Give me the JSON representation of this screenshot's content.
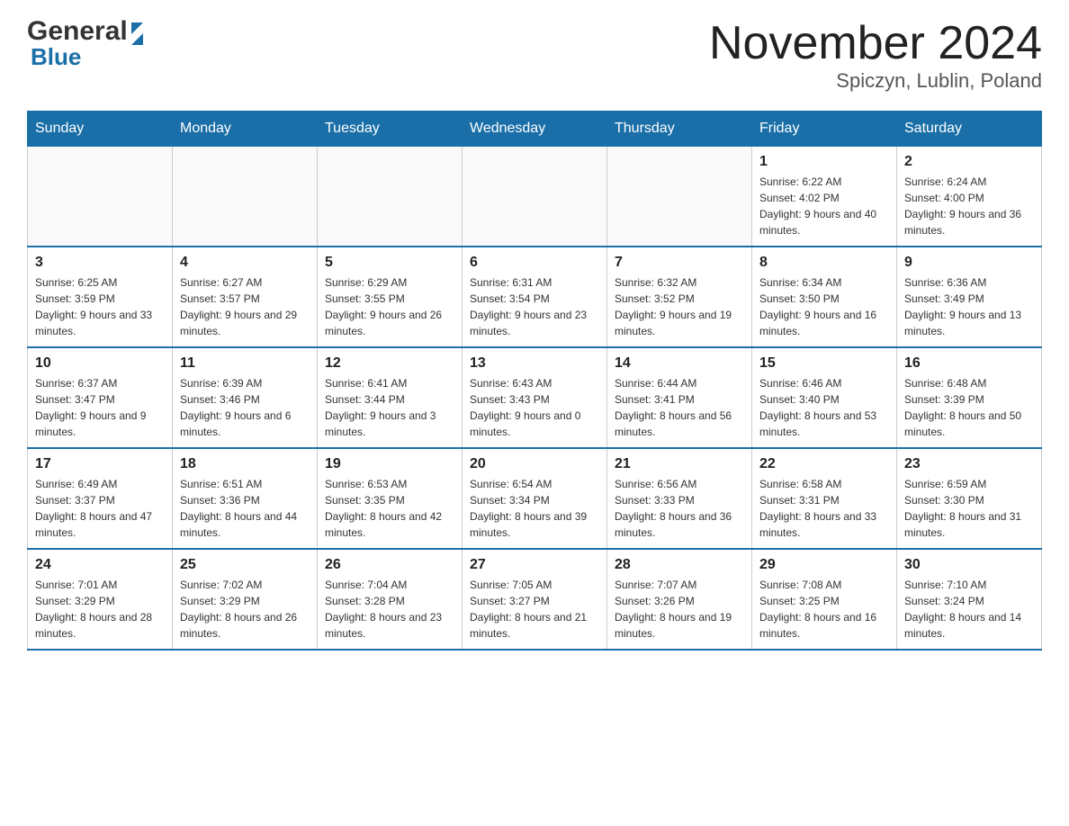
{
  "header": {
    "logo": {
      "general": "General",
      "blue": "Blue"
    },
    "title": "November 2024",
    "subtitle": "Spiczyn, Lublin, Poland"
  },
  "calendar": {
    "days_of_week": [
      "Sunday",
      "Monday",
      "Tuesday",
      "Wednesday",
      "Thursday",
      "Friday",
      "Saturday"
    ],
    "weeks": [
      [
        {
          "day": "",
          "info": ""
        },
        {
          "day": "",
          "info": ""
        },
        {
          "day": "",
          "info": ""
        },
        {
          "day": "",
          "info": ""
        },
        {
          "day": "",
          "info": ""
        },
        {
          "day": "1",
          "info": "Sunrise: 6:22 AM\nSunset: 4:02 PM\nDaylight: 9 hours and 40 minutes."
        },
        {
          "day": "2",
          "info": "Sunrise: 6:24 AM\nSunset: 4:00 PM\nDaylight: 9 hours and 36 minutes."
        }
      ],
      [
        {
          "day": "3",
          "info": "Sunrise: 6:25 AM\nSunset: 3:59 PM\nDaylight: 9 hours and 33 minutes."
        },
        {
          "day": "4",
          "info": "Sunrise: 6:27 AM\nSunset: 3:57 PM\nDaylight: 9 hours and 29 minutes."
        },
        {
          "day": "5",
          "info": "Sunrise: 6:29 AM\nSunset: 3:55 PM\nDaylight: 9 hours and 26 minutes."
        },
        {
          "day": "6",
          "info": "Sunrise: 6:31 AM\nSunset: 3:54 PM\nDaylight: 9 hours and 23 minutes."
        },
        {
          "day": "7",
          "info": "Sunrise: 6:32 AM\nSunset: 3:52 PM\nDaylight: 9 hours and 19 minutes."
        },
        {
          "day": "8",
          "info": "Sunrise: 6:34 AM\nSunset: 3:50 PM\nDaylight: 9 hours and 16 minutes."
        },
        {
          "day": "9",
          "info": "Sunrise: 6:36 AM\nSunset: 3:49 PM\nDaylight: 9 hours and 13 minutes."
        }
      ],
      [
        {
          "day": "10",
          "info": "Sunrise: 6:37 AM\nSunset: 3:47 PM\nDaylight: 9 hours and 9 minutes."
        },
        {
          "day": "11",
          "info": "Sunrise: 6:39 AM\nSunset: 3:46 PM\nDaylight: 9 hours and 6 minutes."
        },
        {
          "day": "12",
          "info": "Sunrise: 6:41 AM\nSunset: 3:44 PM\nDaylight: 9 hours and 3 minutes."
        },
        {
          "day": "13",
          "info": "Sunrise: 6:43 AM\nSunset: 3:43 PM\nDaylight: 9 hours and 0 minutes."
        },
        {
          "day": "14",
          "info": "Sunrise: 6:44 AM\nSunset: 3:41 PM\nDaylight: 8 hours and 56 minutes."
        },
        {
          "day": "15",
          "info": "Sunrise: 6:46 AM\nSunset: 3:40 PM\nDaylight: 8 hours and 53 minutes."
        },
        {
          "day": "16",
          "info": "Sunrise: 6:48 AM\nSunset: 3:39 PM\nDaylight: 8 hours and 50 minutes."
        }
      ],
      [
        {
          "day": "17",
          "info": "Sunrise: 6:49 AM\nSunset: 3:37 PM\nDaylight: 8 hours and 47 minutes."
        },
        {
          "day": "18",
          "info": "Sunrise: 6:51 AM\nSunset: 3:36 PM\nDaylight: 8 hours and 44 minutes."
        },
        {
          "day": "19",
          "info": "Sunrise: 6:53 AM\nSunset: 3:35 PM\nDaylight: 8 hours and 42 minutes."
        },
        {
          "day": "20",
          "info": "Sunrise: 6:54 AM\nSunset: 3:34 PM\nDaylight: 8 hours and 39 minutes."
        },
        {
          "day": "21",
          "info": "Sunrise: 6:56 AM\nSunset: 3:33 PM\nDaylight: 8 hours and 36 minutes."
        },
        {
          "day": "22",
          "info": "Sunrise: 6:58 AM\nSunset: 3:31 PM\nDaylight: 8 hours and 33 minutes."
        },
        {
          "day": "23",
          "info": "Sunrise: 6:59 AM\nSunset: 3:30 PM\nDaylight: 8 hours and 31 minutes."
        }
      ],
      [
        {
          "day": "24",
          "info": "Sunrise: 7:01 AM\nSunset: 3:29 PM\nDaylight: 8 hours and 28 minutes."
        },
        {
          "day": "25",
          "info": "Sunrise: 7:02 AM\nSunset: 3:29 PM\nDaylight: 8 hours and 26 minutes."
        },
        {
          "day": "26",
          "info": "Sunrise: 7:04 AM\nSunset: 3:28 PM\nDaylight: 8 hours and 23 minutes."
        },
        {
          "day": "27",
          "info": "Sunrise: 7:05 AM\nSunset: 3:27 PM\nDaylight: 8 hours and 21 minutes."
        },
        {
          "day": "28",
          "info": "Sunrise: 7:07 AM\nSunset: 3:26 PM\nDaylight: 8 hours and 19 minutes."
        },
        {
          "day": "29",
          "info": "Sunrise: 7:08 AM\nSunset: 3:25 PM\nDaylight: 8 hours and 16 minutes."
        },
        {
          "day": "30",
          "info": "Sunrise: 7:10 AM\nSunset: 3:24 PM\nDaylight: 8 hours and 14 minutes."
        }
      ]
    ]
  }
}
